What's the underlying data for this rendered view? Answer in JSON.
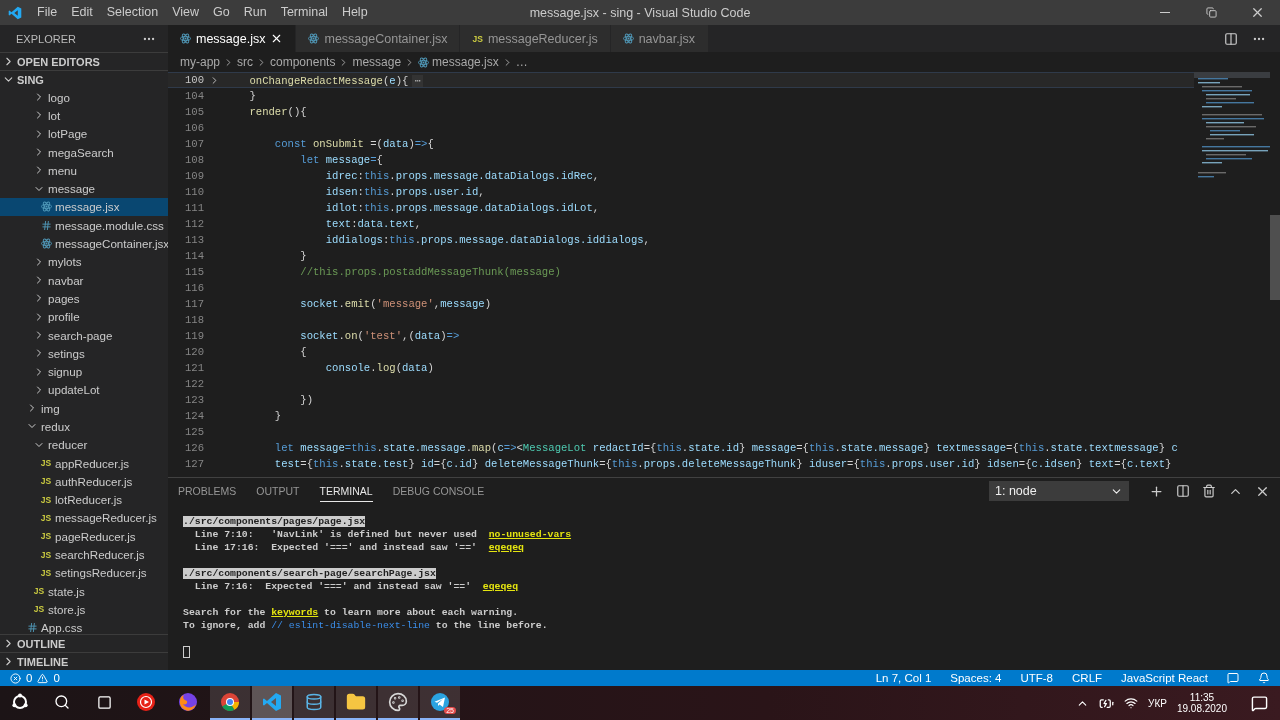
{
  "title_bar": {
    "menus": [
      "File",
      "Edit",
      "Selection",
      "View",
      "Go",
      "Run",
      "Terminal",
      "Help"
    ],
    "title": "message.jsx - sing - Visual Studio Code"
  },
  "sidebar": {
    "title": "EXPLORER",
    "sections": [
      {
        "label": "OPEN EDITORS",
        "expanded": false
      },
      {
        "label": "SING",
        "expanded": true
      }
    ],
    "tree": [
      {
        "kind": "group",
        "children": [
          {
            "label": "logo",
            "kind": "folder",
            "expanded": false,
            "selected": false
          },
          {
            "label": "lot",
            "kind": "folder",
            "expanded": false,
            "selected": false
          },
          {
            "label": "lotPage",
            "kind": "folder",
            "expanded": false,
            "selected": false
          },
          {
            "label": "megaSearch",
            "kind": "folder",
            "expanded": false,
            "selected": false
          },
          {
            "label": "menu",
            "kind": "folder",
            "expanded": false,
            "selected": false
          },
          {
            "label": "message",
            "kind": "folder",
            "expanded": true,
            "selected": false,
            "children": [
              {
                "label": "message.jsx",
                "kind": "react",
                "selected": true
              },
              {
                "label": "message.module.css",
                "kind": "css",
                "selected": false
              },
              {
                "label": "messageContainer.jsx",
                "kind": "react",
                "selected": false
              }
            ]
          },
          {
            "label": "mylots",
            "kind": "folder",
            "expanded": false,
            "selected": false
          },
          {
            "label": "navbar",
            "kind": "folder",
            "expanded": false,
            "selected": false
          },
          {
            "label": "pages",
            "kind": "folder",
            "expanded": false,
            "selected": false
          },
          {
            "label": "profile",
            "kind": "folder",
            "expanded": false,
            "selected": false
          },
          {
            "label": "search-page",
            "kind": "folder",
            "expanded": false,
            "selected": false
          },
          {
            "label": "setings",
            "kind": "folder",
            "expanded": false,
            "selected": false
          },
          {
            "label": "signup",
            "kind": "folder",
            "expanded": false,
            "selected": false
          },
          {
            "label": "updateLot",
            "kind": "folder",
            "expanded": false,
            "selected": false
          }
        ]
      },
      {
        "label": "img",
        "kind": "folder",
        "expanded": false,
        "selected": false
      },
      {
        "label": "redux",
        "kind": "folder",
        "expanded": true,
        "selected": false,
        "children": [
          {
            "label": "reducer",
            "kind": "folder",
            "expanded": true,
            "selected": false,
            "children": [
              {
                "label": "appReducer.js",
                "kind": "js",
                "icon_label": "JS",
                "selected": false
              },
              {
                "label": "authReducer.js",
                "kind": "js",
                "icon_label": "JS",
                "selected": false
              },
              {
                "label": "lotReducer.js",
                "kind": "js",
                "icon_label": "JS",
                "selected": false
              },
              {
                "label": "messageReducer.js",
                "kind": "js",
                "icon_label": "JS",
                "selected": false
              },
              {
                "label": "pageReducer.js",
                "kind": "js",
                "icon_label": "JS",
                "selected": false
              },
              {
                "label": "searchReducer.js",
                "kind": "js",
                "icon_label": "JS",
                "selected": false
              },
              {
                "label": "setingsReducer.js",
                "kind": "js",
                "icon_label": "JS",
                "selected": false
              }
            ]
          },
          {
            "label": "state.js",
            "kind": "js",
            "icon_label": "JS",
            "selected": false
          },
          {
            "label": "store.js",
            "kind": "js",
            "icon_label": "JS",
            "selected": false
          }
        ]
      },
      {
        "label": "App.css",
        "kind": "css",
        "selected": false
      }
    ],
    "bottom_sections": [
      {
        "label": "OUTLINE",
        "expanded": false
      },
      {
        "label": "TIMELINE",
        "expanded": false
      }
    ]
  },
  "tabs": [
    {
      "label": "message.jsx",
      "kind": "react",
      "selected": true
    },
    {
      "label": "messageContainer.jsx",
      "kind": "react",
      "selected": false
    },
    {
      "label": "messageReducer.js",
      "kind": "js",
      "icon_label": "JS",
      "selected": false
    },
    {
      "label": "navbar.jsx",
      "kind": "react",
      "selected": false
    }
  ],
  "breadcrumb": [
    {
      "label": "my-app",
      "kind": "folder"
    },
    {
      "label": "src",
      "kind": "folder"
    },
    {
      "label": "components",
      "kind": "folder"
    },
    {
      "label": "message",
      "kind": "folder"
    },
    {
      "label": "message.jsx",
      "kind": "react"
    },
    {
      "label": "…",
      "kind": "more"
    }
  ],
  "editor": {
    "lines": [
      {
        "number": "100",
        "current": true,
        "folded": true,
        "tokens": [
          {
            "kind": "function",
            "text": "    onChangeRedactMessage"
          },
          {
            "kind": "plain",
            "text": "("
          },
          {
            "kind": "variable",
            "text": "e"
          },
          {
            "kind": "plain",
            "text": "){"
          },
          {
            "kind": "fold",
            "text": "⋯"
          }
        ]
      },
      {
        "number": "104",
        "current": false,
        "folded": false,
        "tokens": [
          {
            "kind": "plain",
            "text": "    }"
          }
        ]
      },
      {
        "number": "105",
        "current": false,
        "folded": false,
        "tokens": [
          {
            "kind": "function",
            "text": "    render"
          },
          {
            "kind": "plain",
            "text": "(){"
          }
        ]
      },
      {
        "number": "106",
        "current": false,
        "folded": false
      },
      {
        "number": "107",
        "current": false,
        "folded": false,
        "tokens": [
          {
            "kind": "keyword",
            "text": "        const "
          },
          {
            "kind": "function",
            "text": "onSubmit"
          },
          {
            "kind": "plain",
            "text": " =("
          },
          {
            "kind": "variable",
            "text": "data"
          },
          {
            "kind": "plain",
            "text": ")"
          },
          {
            "kind": "keyword",
            "text": "=>"
          },
          {
            "kind": "plain",
            "text": "{"
          }
        ]
      },
      {
        "number": "108",
        "current": false,
        "folded": false,
        "tokens": [
          {
            "kind": "keyword",
            "text": "            let "
          },
          {
            "kind": "variable",
            "text": "message"
          },
          {
            "kind": "keyword",
            "text": "="
          },
          {
            "kind": "plain",
            "text": "{"
          }
        ]
      },
      {
        "number": "109",
        "current": false,
        "folded": false,
        "tokens": [
          {
            "kind": "variable",
            "text": "                idrec"
          },
          {
            "kind": "plain",
            "text": ":"
          },
          {
            "kind": "keyword",
            "text": "this"
          },
          {
            "kind": "plain",
            "text": "."
          },
          {
            "kind": "variable",
            "text": "props.message.dataDialogs.idRec"
          },
          {
            "kind": "plain",
            "text": ","
          }
        ]
      },
      {
        "number": "110",
        "current": false,
        "folded": false,
        "tokens": [
          {
            "kind": "variable",
            "text": "                idsen"
          },
          {
            "kind": "plain",
            "text": ":"
          },
          {
            "kind": "keyword",
            "text": "this"
          },
          {
            "kind": "plain",
            "text": "."
          },
          {
            "kind": "variable",
            "text": "props.user.id"
          },
          {
            "kind": "plain",
            "text": ","
          }
        ]
      },
      {
        "number": "111",
        "current": false,
        "folded": false,
        "tokens": [
          {
            "kind": "variable",
            "text": "                idlot"
          },
          {
            "kind": "plain",
            "text": ":"
          },
          {
            "kind": "keyword",
            "text": "this"
          },
          {
            "kind": "plain",
            "text": "."
          },
          {
            "kind": "variable",
            "text": "props.message.dataDialogs.idLot"
          },
          {
            "kind": "plain",
            "text": ","
          }
        ]
      },
      {
        "number": "112",
        "current": false,
        "folded": false,
        "tokens": [
          {
            "kind": "variable",
            "text": "                text"
          },
          {
            "kind": "plain",
            "text": ":"
          },
          {
            "kind": "variable",
            "text": "data.text"
          },
          {
            "kind": "plain",
            "text": ","
          }
        ]
      },
      {
        "number": "113",
        "current": false,
        "folded": false,
        "tokens": [
          {
            "kind": "variable",
            "text": "                iddialogs"
          },
          {
            "kind": "plain",
            "text": ":"
          },
          {
            "kind": "keyword",
            "text": "this"
          },
          {
            "kind": "plain",
            "text": "."
          },
          {
            "kind": "variable",
            "text": "props.message.dataDialogs.iddialogs"
          },
          {
            "kind": "plain",
            "text": ","
          }
        ]
      },
      {
        "number": "114",
        "current": false,
        "folded": false,
        "tokens": [
          {
            "kind": "plain",
            "text": "            }"
          }
        ]
      },
      {
        "number": "115",
        "current": false,
        "folded": false,
        "tokens": [
          {
            "kind": "comment",
            "text": "            //this.props.postaddMessageThunk(message)"
          }
        ]
      },
      {
        "number": "116",
        "current": false,
        "folded": false
      },
      {
        "number": "117",
        "current": false,
        "folded": false,
        "tokens": [
          {
            "kind": "variable",
            "text": "            socket"
          },
          {
            "kind": "plain",
            "text": "."
          },
          {
            "kind": "function",
            "text": "emit"
          },
          {
            "kind": "plain",
            "text": "("
          },
          {
            "kind": "string",
            "text": "'message'"
          },
          {
            "kind": "plain",
            "text": ","
          },
          {
            "kind": "variable",
            "text": "message"
          },
          {
            "kind": "plain",
            "text": ")"
          }
        ]
      },
      {
        "number": "118",
        "current": false,
        "folded": false
      },
      {
        "number": "119",
        "current": false,
        "folded": false,
        "tokens": [
          {
            "kind": "variable",
            "text": "            socket"
          },
          {
            "kind": "plain",
            "text": "."
          },
          {
            "kind": "function",
            "text": "on"
          },
          {
            "kind": "plain",
            "text": "("
          },
          {
            "kind": "string",
            "text": "'test'"
          },
          {
            "kind": "plain",
            "text": ",("
          },
          {
            "kind": "variable",
            "text": "data"
          },
          {
            "kind": "plain",
            "text": ")"
          },
          {
            "kind": "keyword",
            "text": "=>"
          }
        ]
      },
      {
        "number": "120",
        "current": false,
        "folded": false,
        "tokens": [
          {
            "kind": "plain",
            "text": "            {"
          }
        ]
      },
      {
        "number": "121",
        "current": false,
        "folded": false,
        "tokens": [
          {
            "kind": "variable",
            "text": "                console"
          },
          {
            "kind": "plain",
            "text": "."
          },
          {
            "kind": "function",
            "text": "log"
          },
          {
            "kind": "plain",
            "text": "("
          },
          {
            "kind": "variable",
            "text": "data"
          },
          {
            "kind": "plain",
            "text": ")"
          }
        ]
      },
      {
        "number": "122",
        "current": false,
        "folded": false
      },
      {
        "number": "123",
        "current": false,
        "folded": false,
        "tokens": [
          {
            "kind": "plain",
            "text": "            })"
          }
        ]
      },
      {
        "number": "124",
        "current": false,
        "folded": false,
        "tokens": [
          {
            "kind": "plain",
            "text": "        }"
          }
        ]
      },
      {
        "number": "125",
        "current": false,
        "folded": false
      },
      {
        "number": "126",
        "current": false,
        "folded": false,
        "tokens": [
          {
            "kind": "keyword",
            "text": "        let "
          },
          {
            "kind": "variable",
            "text": "message"
          },
          {
            "kind": "keyword",
            "text": "="
          },
          {
            "kind": "keyword",
            "text": "this"
          },
          {
            "kind": "plain",
            "text": "."
          },
          {
            "kind": "variable",
            "text": "state.message"
          },
          {
            "kind": "plain",
            "text": "."
          },
          {
            "kind": "function",
            "text": "map"
          },
          {
            "kind": "plain",
            "text": "("
          },
          {
            "kind": "variable",
            "text": "c"
          },
          {
            "kind": "keyword",
            "text": "=>"
          },
          {
            "kind": "plain",
            "text": "<"
          },
          {
            "kind": "component",
            "text": "MessageLot"
          },
          {
            "kind": "variable",
            "text": " redactId"
          },
          {
            "kind": "plain",
            "text": "={"
          },
          {
            "kind": "keyword",
            "text": "this"
          },
          {
            "kind": "plain",
            "text": "."
          },
          {
            "kind": "variable",
            "text": "state.id"
          },
          {
            "kind": "plain",
            "text": "} "
          },
          {
            "kind": "variable",
            "text": "message"
          },
          {
            "kind": "plain",
            "text": "={"
          },
          {
            "kind": "keyword",
            "text": "this"
          },
          {
            "kind": "plain",
            "text": "."
          },
          {
            "kind": "variable",
            "text": "state.message"
          },
          {
            "kind": "plain",
            "text": "} "
          },
          {
            "kind": "variable",
            "text": "textmessage"
          },
          {
            "kind": "plain",
            "text": "={"
          },
          {
            "kind": "keyword",
            "text": "this"
          },
          {
            "kind": "plain",
            "text": "."
          },
          {
            "kind": "variable",
            "text": "state.textmessage"
          },
          {
            "kind": "plain",
            "text": "} "
          },
          {
            "kind": "variable",
            "text": "c"
          }
        ]
      },
      {
        "number": "127",
        "current": false,
        "folded": false,
        "tokens": [
          {
            "kind": "variable",
            "text": "        test"
          },
          {
            "kind": "plain",
            "text": "={"
          },
          {
            "kind": "keyword",
            "text": "this"
          },
          {
            "kind": "plain",
            "text": "."
          },
          {
            "kind": "variable",
            "text": "state.test"
          },
          {
            "kind": "plain",
            "text": "} "
          },
          {
            "kind": "variable",
            "text": "id"
          },
          {
            "kind": "plain",
            "text": "={"
          },
          {
            "kind": "variable",
            "text": "c.id"
          },
          {
            "kind": "plain",
            "text": "} "
          },
          {
            "kind": "variable",
            "text": "deleteMessageThunk"
          },
          {
            "kind": "plain",
            "text": "={"
          },
          {
            "kind": "keyword",
            "text": "this"
          },
          {
            "kind": "plain",
            "text": "."
          },
          {
            "kind": "variable",
            "text": "props.deleteMessageThunk"
          },
          {
            "kind": "plain",
            "text": "} "
          },
          {
            "kind": "variable",
            "text": "iduser"
          },
          {
            "kind": "plain",
            "text": "={"
          },
          {
            "kind": "keyword",
            "text": "this"
          },
          {
            "kind": "plain",
            "text": "."
          },
          {
            "kind": "variable",
            "text": "props.user.id"
          },
          {
            "kind": "plain",
            "text": "} "
          },
          {
            "kind": "variable",
            "text": "idsen"
          },
          {
            "kind": "plain",
            "text": "={"
          },
          {
            "kind": "variable",
            "text": "c.idsen"
          },
          {
            "kind": "plain",
            "text": "} "
          },
          {
            "kind": "variable",
            "text": "text"
          },
          {
            "kind": "plain",
            "text": "={"
          },
          {
            "kind": "variable",
            "text": "c.text"
          },
          {
            "kind": "plain",
            "text": "}"
          }
        ]
      }
    ]
  },
  "panel": {
    "tabs": [
      {
        "label": "PROBLEMS",
        "selected": false
      },
      {
        "label": "OUTPUT",
        "selected": false
      },
      {
        "label": "TERMINAL",
        "selected": true
      },
      {
        "label": "DEBUG CONSOLE",
        "selected": false
      }
    ],
    "terminal_picker": "1: node",
    "terminal_blocks": [
      {
        "lines": [
          {
            "segments": [
              {
                "kind": "path",
                "text": "./src/components/pages/page.jsx"
              }
            ]
          },
          {
            "segments": [
              {
                "kind": "plain",
                "text": "  Line 7:10:   'NavLink' is defined but never used  "
              },
              {
                "kind": "rule",
                "text": "no-unused-vars"
              }
            ]
          },
          {
            "segments": [
              {
                "kind": "plain",
                "text": "  Line 17:16:  Expected '===' and instead saw '=='  "
              },
              {
                "kind": "rule",
                "text": "eqeqeq"
              }
            ]
          }
        ]
      },
      {
        "lines": [
          {
            "segments": [
              {
                "kind": "path",
                "text": "./src/components/search-page/searchPage.jsx"
              }
            ]
          },
          {
            "segments": [
              {
                "kind": "plain",
                "text": "  Line 7:16:  Expected '===' and instead saw '=='  "
              },
              {
                "kind": "rule",
                "text": "eqeqeq"
              }
            ]
          }
        ]
      },
      {
        "lines": [
          {
            "segments": [
              {
                "kind": "plain",
                "text": "Search for the "
              },
              {
                "kind": "rule",
                "text": "keywords"
              },
              {
                "kind": "plain",
                "text": " to learn more about each warning."
              }
            ]
          },
          {
            "segments": [
              {
                "kind": "plain",
                "text": "To ignore, add "
              },
              {
                "kind": "link",
                "text": "// eslint-disable-next-line"
              },
              {
                "kind": "plain",
                "text": " to the line before."
              }
            ]
          }
        ]
      }
    ]
  },
  "status_bar": {
    "errors": "0",
    "warnings": "0",
    "items": [
      "Ln 7, Col 1",
      "Spaces: 4",
      "UTF-8",
      "CRLF",
      "JavaScript React"
    ]
  },
  "taskbar": {
    "apps": [
      {
        "kind": "play",
        "running": false,
        "focused": false
      },
      {
        "kind": "fox",
        "running": false,
        "focused": false
      },
      {
        "kind": "browser",
        "running": true,
        "focused": false
      },
      {
        "kind": "editor",
        "running": true,
        "focused": true
      },
      {
        "kind": "database",
        "running": true,
        "focused": false
      },
      {
        "kind": "folder",
        "running": true,
        "focused": false
      },
      {
        "kind": "palette",
        "running": true,
        "focused": false
      },
      {
        "kind": "plane",
        "running": true,
        "focused": false,
        "badge": "25"
      }
    ],
    "language": "УКР",
    "time": "11:35",
    "date": "19.08.2020"
  }
}
